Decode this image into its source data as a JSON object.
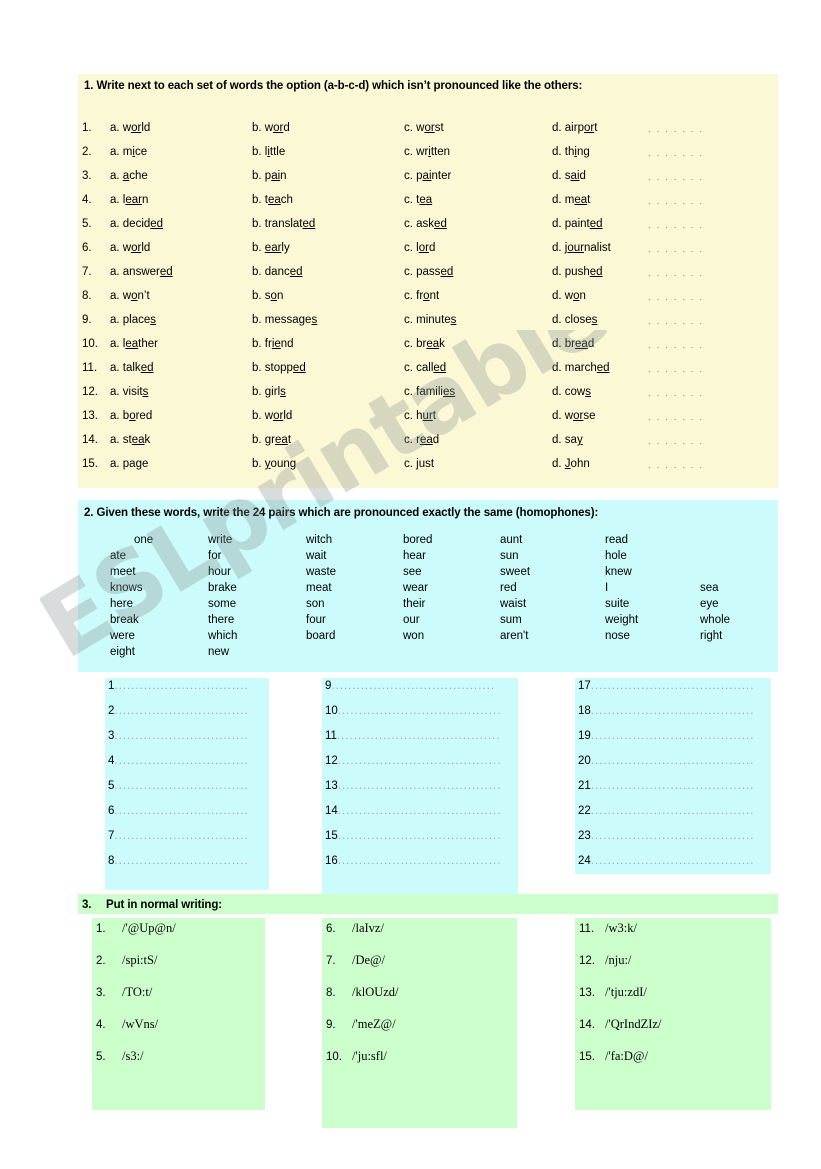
{
  "watermark": {
    "text": "ESLprintables.com"
  },
  "colors": {
    "section1_bg": "#FBF8D5",
    "section2_bg": "#CCFBFB",
    "section3_bg": "#CCFFCC",
    "text": "#000000",
    "dots": "#9AA8A8"
  },
  "section1": {
    "heading": "1. Write next to each set of words the option (a-b-c-d) which isn’t pronounced like the others:",
    "blank": ". . . . . . .",
    "rows": [
      {
        "n": "1.",
        "a": [
          "a. w",
          "or",
          "ld"
        ],
        "b": [
          "b. w",
          "or",
          "d"
        ],
        "c": [
          "c. w",
          "or",
          "st"
        ],
        "d": [
          "d. airp",
          "or",
          "t"
        ]
      },
      {
        "n": "2.",
        "a": [
          "a. m",
          "i",
          "ce"
        ],
        "b": [
          "b. l",
          "i",
          "ttle"
        ],
        "c": [
          "c. wr",
          "i",
          "tten"
        ],
        "d": [
          "d. th",
          "i",
          "ng"
        ]
      },
      {
        "n": "3.",
        "a": [
          "a. ",
          "a",
          "che"
        ],
        "b": [
          "b. p",
          "ai",
          "n"
        ],
        "c": [
          "c. p",
          "ai",
          "nter"
        ],
        "d": [
          "d. s",
          "ai",
          "d"
        ]
      },
      {
        "n": "4.",
        "a": [
          "a. l",
          "ear",
          "n"
        ],
        "b": [
          "b. t",
          "ea",
          "ch"
        ],
        "c": [
          "c. t",
          "ea",
          ""
        ],
        "d": [
          "d. m",
          "ea",
          "t"
        ]
      },
      {
        "n": "5.",
        "a": [
          "a. decid",
          "ed",
          ""
        ],
        "b": [
          "b. translat",
          "ed",
          ""
        ],
        "c": [
          "c. ask",
          "ed",
          ""
        ],
        "d": [
          "d. paint",
          "ed",
          ""
        ]
      },
      {
        "n": "6.",
        "a": [
          "a. w",
          "or",
          "ld"
        ],
        "b": [
          "b. ",
          "ear",
          "ly"
        ],
        "c": [
          "c. l",
          "or",
          "d"
        ],
        "d": [
          "d. j",
          "our",
          "nalist"
        ]
      },
      {
        "n": "7.",
        "a": [
          "a. answer",
          "ed",
          ""
        ],
        "b": [
          "b. danc",
          "ed",
          ""
        ],
        "c": [
          "c. pass",
          "ed",
          ""
        ],
        "d": [
          "d. push",
          "ed",
          ""
        ]
      },
      {
        "n": "8.",
        "a": [
          "a. w",
          "o",
          "n’t"
        ],
        "b": [
          "b. s",
          "o",
          "n"
        ],
        "c": [
          "c. fr",
          "o",
          "nt"
        ],
        "d": [
          "d. w",
          "o",
          "n"
        ]
      },
      {
        "n": "9.",
        "a": [
          "a. place",
          "s",
          ""
        ],
        "b": [
          "b. message",
          "s",
          ""
        ],
        "c": [
          "c. minute",
          "s",
          ""
        ],
        "d": [
          "d. close",
          "s",
          ""
        ]
      },
      {
        "n": "10.",
        "a": [
          "a. l",
          "ea",
          "ther"
        ],
        "b": [
          "b. fr",
          "ie",
          "nd"
        ],
        "c": [
          "c. br",
          "ea",
          "k"
        ],
        "d": [
          "d. br",
          "ea",
          "d"
        ]
      },
      {
        "n": "11.",
        "a": [
          "a. talk",
          "ed",
          ""
        ],
        "b": [
          "b. stopp",
          "ed",
          ""
        ],
        "c": [
          "c. call",
          "ed",
          ""
        ],
        "d": [
          "d. march",
          "ed",
          ""
        ]
      },
      {
        "n": "12.",
        "a": [
          "a. visit",
          "s",
          ""
        ],
        "b": [
          "b. girl",
          "s",
          ""
        ],
        "c": [
          "c. famili",
          "es",
          ""
        ],
        "d": [
          "d. cow",
          "s",
          ""
        ]
      },
      {
        "n": "13.",
        "a": [
          "a. b",
          "o",
          "red"
        ],
        "b": [
          "b. w",
          "or",
          "ld"
        ],
        "c": [
          "c. h",
          "ur",
          "t"
        ],
        "d": [
          "d. w",
          "or",
          "se"
        ]
      },
      {
        "n": "14.",
        "a": [
          "a. st",
          "ea",
          "k"
        ],
        "b": [
          "b. gr",
          "ea",
          "t"
        ],
        "c": [
          "c. r",
          "ea",
          "d"
        ],
        "d": [
          "d. sa",
          "y",
          ""
        ]
      },
      {
        "n": "15.",
        "a": [
          "a. pa",
          "g",
          "e"
        ],
        "b": [
          "b. ",
          "y",
          "oung"
        ],
        "c": [
          "c. just",
          "",
          ""
        ],
        "d": [
          "d. ",
          "J",
          "ohn"
        ]
      }
    ]
  },
  "section2": {
    "heading": "2. Given these words, write the 24 pairs which are pronounced exactly the same (homophones):",
    "word_bank_columns": [
      [
        "one",
        "ate",
        "meet",
        "knows",
        "here",
        "break",
        "were",
        "eight"
      ],
      [
        "write",
        "for",
        "hour",
        "brake",
        "some",
        "there",
        "which",
        "new"
      ],
      [
        "witch",
        "wait",
        "waste",
        "meat",
        "son",
        "four",
        "board"
      ],
      [
        "bored",
        "hear",
        "see",
        "wear",
        "their",
        "our",
        "won"
      ],
      [
        "aunt",
        "sun",
        "sweet",
        "red",
        "waist",
        "sum",
        "aren't"
      ],
      [
        "read",
        "hole",
        "knew",
        "I",
        "suite",
        "weight",
        "nose"
      ],
      [
        "sea",
        "eye",
        "whole",
        "right"
      ]
    ],
    "answer_columns": [
      [
        "1",
        "2",
        "3",
        "4",
        "5",
        "6",
        "7",
        "8"
      ],
      [
        "9",
        "10",
        "11",
        "12",
        "13",
        "14",
        "15",
        "16"
      ],
      [
        "17",
        "18",
        "19",
        "20",
        "21",
        "22",
        "23",
        "24"
      ]
    ],
    "dots_short": "................................",
    "dots_long": "......................................."
  },
  "section3": {
    "number": "3.",
    "heading": "Put in normal writing:",
    "columns": [
      [
        {
          "n": "1.",
          "t": "/'@Up@n/"
        },
        {
          "n": "2.",
          "t": "/spi:tS/"
        },
        {
          "n": "3.",
          "t": "/TO:t/"
        },
        {
          "n": "4.",
          "t": "/wVns/"
        },
        {
          "n": "5.",
          "t": "/s3:/"
        }
      ],
      [
        {
          "n": "6.",
          "t": "/laIvz/"
        },
        {
          "n": "7.",
          "t": "/De@/"
        },
        {
          "n": "8.",
          "t": "/klOUzd/"
        },
        {
          "n": "9.",
          "t": "/'meZ@/"
        },
        {
          "n": "10.",
          "t": "/'ju:sfl/"
        }
      ],
      [
        {
          "n": "11.",
          "t": "/w3:k/"
        },
        {
          "n": "12.",
          "t": "/nju:/"
        },
        {
          "n": "13.",
          "t": "/'tju:zdI/"
        },
        {
          "n": "14.",
          "t": "/'QrIndZIz/"
        },
        {
          "n": "15.",
          "t": "/'fa:D@/"
        }
      ]
    ]
  }
}
